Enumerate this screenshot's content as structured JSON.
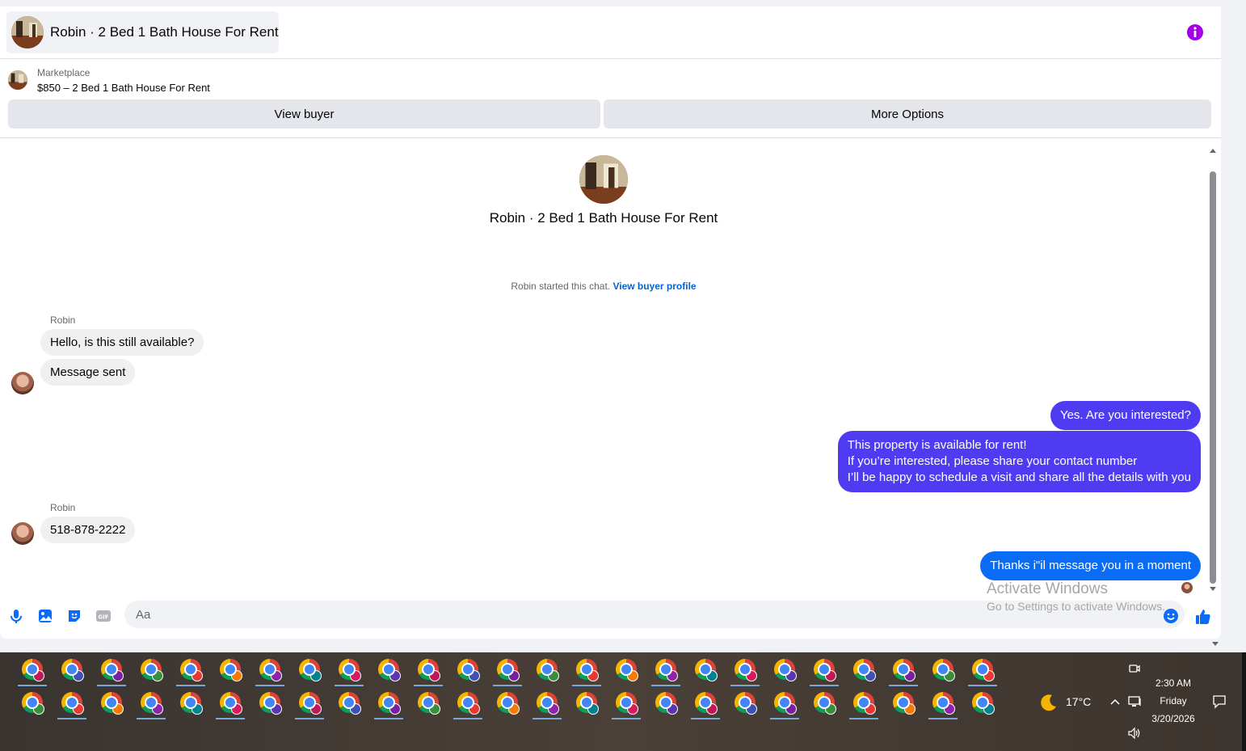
{
  "header": {
    "title": "Robin · 2 Bed 1 Bath House For Rent",
    "accent_color": "#a400e6"
  },
  "listing": {
    "label": "Marketplace",
    "price_title": "$850 – 2 Bed 1 Bath House For Rent",
    "view_buyer_label": "View buyer",
    "more_options_label": "More Options"
  },
  "thread": {
    "title": "Robin · 2 Bed 1 Bath House For Rent",
    "started_text": "Robin started this chat.",
    "view_profile_link": "View buyer profile",
    "messages": [
      {
        "sender": "Robin",
        "text": "Hello, is this still available?"
      },
      {
        "text": "Message sent"
      },
      {
        "text": "Yes. Are you interested?"
      },
      {
        "lines": [
          "This property is available for rent!",
          "If you’re interested, please share your contact number",
          "I’ll be happy to schedule a visit and share all the details with you"
        ]
      },
      {
        "sender": "Robin",
        "text": "518-878-2222"
      },
      {
        "text": "Thanks i\"il message you in a moment"
      }
    ]
  },
  "composer": {
    "placeholder": "Aa",
    "icons": [
      "microphone-icon",
      "image-icon",
      "sticker-icon",
      "gif-icon",
      "emoji-icon",
      "thumbs-up-icon"
    ],
    "gif_label": "GIF"
  },
  "watermark": {
    "line1": "Activate Windows",
    "line2": "Go to Settings to activate Windows."
  },
  "taskbar": {
    "weather_temp": "17°C",
    "time": "2:30 AM",
    "day": "Friday",
    "date": "3/20/2026"
  }
}
